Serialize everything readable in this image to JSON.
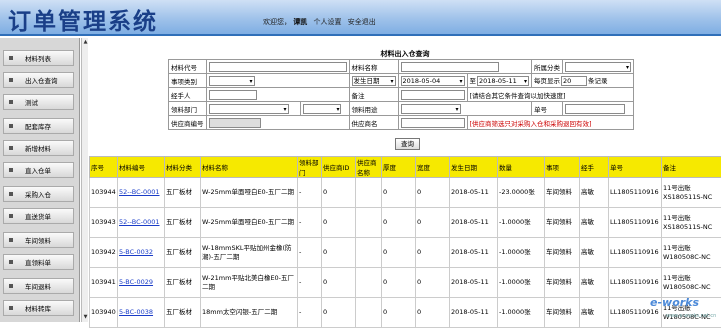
{
  "header": {
    "title": "订单管理系统",
    "welcome": "欢迎您，",
    "user": "谭凯",
    "links": [
      "个人设置",
      "安全退出"
    ]
  },
  "sidebar": {
    "items": [
      {
        "label": "材料列表"
      },
      {
        "label": "出入仓查询"
      },
      {
        "label": "测试"
      },
      {
        "label": "配套库存"
      },
      {
        "label": "新增材料"
      },
      {
        "label": "直入仓单"
      },
      {
        "label": "采购入仓"
      },
      {
        "label": "直送货单"
      },
      {
        "label": "车间领料"
      },
      {
        "label": "直领料单"
      },
      {
        "label": "车间退料"
      },
      {
        "label": "材料转库"
      }
    ]
  },
  "query": {
    "title": "材料出入仓查询",
    "material_code_label": "材料代号",
    "material_name_label": "材料名称",
    "category_label": "所属分类",
    "event_type_label": "事项类别",
    "date_select": "发生日期",
    "date_from": "2018-05-04",
    "to_label": "至",
    "date_to": "2018-05-11",
    "page_size_label": "每页显示",
    "page_size": "20",
    "records_label": "条记录",
    "handler_label": "经手人",
    "remark_label": "备注",
    "remark_hint": "[请结合其它条件查询以加快速度]",
    "dept_label": "领料部门",
    "usage_label": "领料用途",
    "doc_no_label": "单号",
    "supplier_code_label": "供应商编号",
    "supplier_name_label": "供应商名",
    "supplier_hint": "[供应商筛选只对采购入仓和采购退回有效]",
    "search_button": "查询"
  },
  "table": {
    "headers": [
      "序号",
      "材料编号",
      "材料分类",
      "材料名称",
      "领料部门",
      "供应商ID",
      "供应商名称",
      "厚度",
      "宽度",
      "发生日期",
      "数量",
      "事项",
      "经手",
      "单号",
      "备注"
    ],
    "rows": [
      [
        "103944",
        "52--BC-0001",
        "五厂板材",
        "W-25mm单面哑白E0-五厂二期",
        "-",
        "0",
        "",
        "0",
        "0",
        "2018-05-11",
        "-23.0000张",
        "车间领料",
        "高敏",
        "LL1805110916",
        "11号出账XS180511S-NC"
      ],
      [
        "103943",
        "52--BC-0001",
        "五厂板材",
        "W-25mm单面哑白E0-五厂二期",
        "-",
        "0",
        "",
        "0",
        "0",
        "2018-05-11",
        "-1.0000张",
        "车间领料",
        "高敏",
        "LL1805110916",
        "11号出账XS180511S-NC"
      ],
      [
        "103942",
        "5-BC-0032",
        "五厂板材",
        "W-18mmSKL平贴加州金橡(防潮)-五厂二期",
        "-",
        "0",
        "",
        "0",
        "0",
        "2018-05-11",
        "-1.0000张",
        "车间领料",
        "高敏",
        "LL1805110916",
        "11号出账W180508C-NC"
      ],
      [
        "103941",
        "5-BC-0029",
        "五厂板材",
        "W-21mm平贴北美白橡E0-五厂二期",
        "-",
        "0",
        "",
        "0",
        "0",
        "2018-05-11",
        "-1.0000张",
        "车间领料",
        "高敏",
        "LL1805110916",
        "11号出账W180508C-NC"
      ],
      [
        "103940",
        "5-BC-0038",
        "五厂板材",
        "18mm太空闪银-五厂二期",
        "-",
        "0",
        "",
        "0",
        "0",
        "2018-05-11",
        "-1.0000张",
        "车间领料",
        "高敏",
        "LL1805110916",
        "11号出账W180508C-NC"
      ]
    ]
  },
  "watermark": {
    "main": "e-works",
    "sub": "www.e-works.net.cn"
  }
}
